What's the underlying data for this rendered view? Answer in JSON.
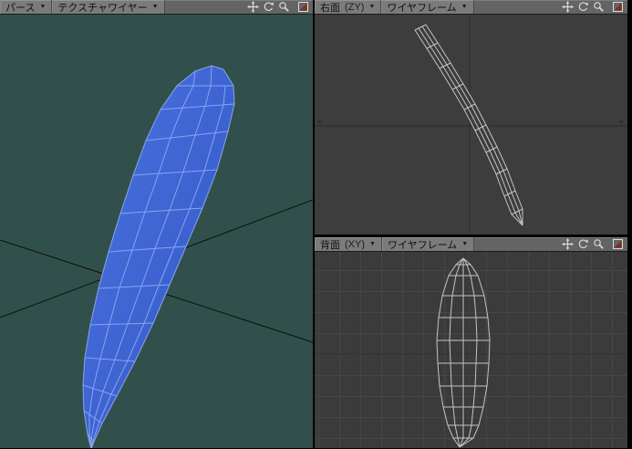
{
  "ui": {
    "dropdown_arrow": "▼"
  },
  "viewports": {
    "perspective": {
      "view_label": "パース",
      "mode_label": "テクスチャワイヤー"
    },
    "side": {
      "view_label": "右面",
      "axis_label": "(ZY)",
      "mode_label": "ワイヤフレーム",
      "axis_mark_left": "+",
      "axis_mark_right": "+"
    },
    "back": {
      "view_label": "背面",
      "axis_label": "(XY)",
      "mode_label": "ワイヤフレーム"
    }
  },
  "toolbar": {
    "icons": [
      "pan",
      "rotate",
      "zoom",
      "maximize"
    ]
  },
  "colors": {
    "perspective_bg": "#32504b",
    "side_bg": "#3d3d3d",
    "back_bg": "#3b3b3b",
    "header_bg": "#646464",
    "object_fill": "#3f68d8",
    "object_wire": "#88a4ef",
    "wireframe": "#c4c4c4",
    "grid": "#464646",
    "axis": "#2c2c2c",
    "maximize_accent": "#7e2f23"
  }
}
